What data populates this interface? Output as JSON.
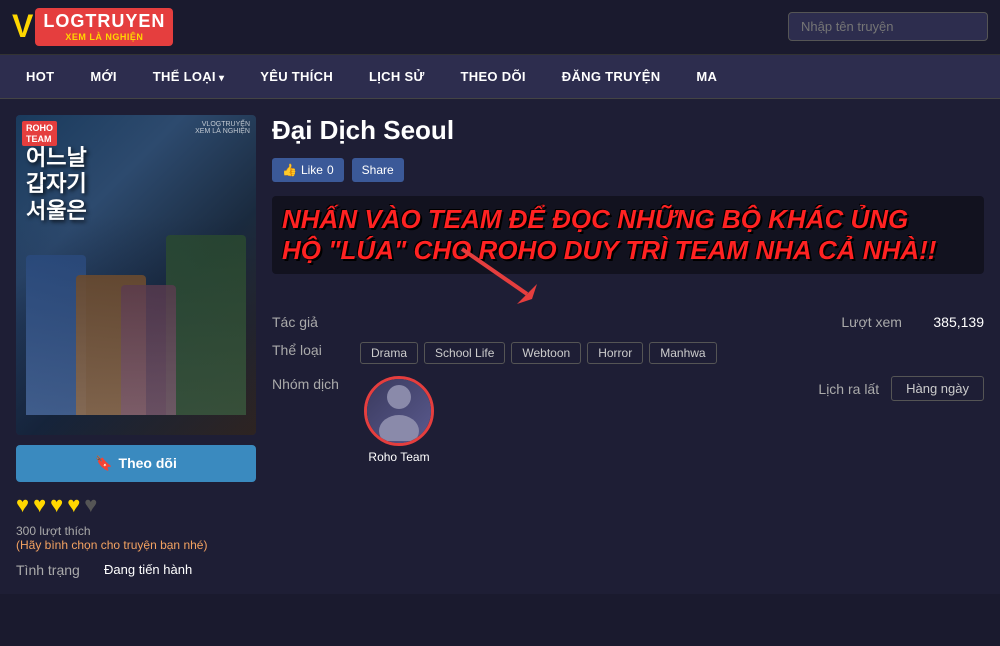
{
  "header": {
    "logo_v": "V",
    "logo_main": "LOGTRUYEN",
    "logo_sub": "XEM LÀ NGHIỆN",
    "search_placeholder": "Nhập tên truyện"
  },
  "nav": {
    "items": [
      {
        "id": "hot",
        "label": "HOT",
        "has_arrow": false
      },
      {
        "id": "moi",
        "label": "MỚI",
        "has_arrow": false
      },
      {
        "id": "the_loai",
        "label": "THỂ LOẠI",
        "has_arrow": true
      },
      {
        "id": "yeu_thich",
        "label": "YÊU THÍCH",
        "has_arrow": false
      },
      {
        "id": "lich_su",
        "label": "LỊCH SỬ",
        "has_arrow": false
      },
      {
        "id": "theo_doi",
        "label": "THEO DÕI",
        "has_arrow": false
      },
      {
        "id": "dang_truyen",
        "label": "ĐĂNG TRUYỆN",
        "has_arrow": false
      },
      {
        "id": "ma",
        "label": "MA",
        "has_arrow": false
      }
    ]
  },
  "manga": {
    "title": "Đại Dịch Seoul",
    "cover_label_top": "ROHO",
    "cover_label_bottom": "TEAM",
    "cover_watermark": "VLOGTRUYẾN\nXEM LÀ NGHIỆN",
    "cover_title_korean": "어느날\n갑자기\n서울은",
    "follow_label": "Theo dõi",
    "like_label": "Like",
    "like_count": "0",
    "share_label": "Share",
    "promo_line1": "NHẤN VÀO TEAM ĐỂ ĐỌC NHỮNG BỘ KHÁC ỦNG",
    "promo_line2": "HỘ \"LÚA\" CHO ROHO DUY TRÌ TEAM NHA CẢ NHÀ!!",
    "tac_gia_label": "Tác giả",
    "tac_gia_value": "",
    "luot_xem_label": "Lượt xem",
    "luot_xem_value": "385,139",
    "the_loai_label": "Thể loại",
    "genres": [
      "Drama",
      "School Life",
      "Webtoon",
      "Horror",
      "Manhwa"
    ],
    "nhom_dich_label": "Nhóm dịch",
    "group_name": "Roho Team",
    "lich_ra_mat_label": "Lịch ra lất",
    "lich_ra_mat_value": "Hàng ngày",
    "rating_count": "300 lượt thích",
    "rating_prompt": "(Hãy bình chọn cho truyện bạn nhé)",
    "tinh_trang_label": "Tình trạng",
    "tinh_trang_value": "Đang tiến hành",
    "hearts_filled": 4,
    "hearts_empty": 1
  }
}
